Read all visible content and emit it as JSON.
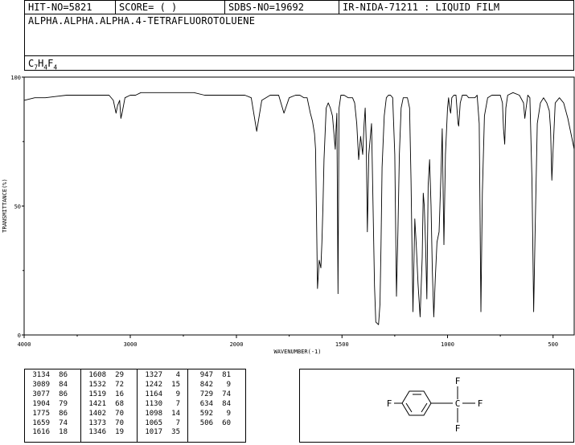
{
  "header": {
    "hit_no": "HIT-NO=5821",
    "score": "SCORE=  (   )",
    "sdbs_no": "SDBS-NO=19692",
    "ir_info": "IR-NIDA-71211 : LIQUID FILM"
  },
  "compound": {
    "name": "ALPHA.ALPHA.ALPHA.4-TETRAFLUOROTOLUENE",
    "formula_parts": [
      {
        "t": "C",
        "sub": false
      },
      {
        "t": "7",
        "sub": true
      },
      {
        "t": "H",
        "sub": false
      },
      {
        "t": "4",
        "sub": true
      },
      {
        "t": "F",
        "sub": false
      },
      {
        "t": "4",
        "sub": true
      }
    ]
  },
  "chart_data": {
    "type": "line",
    "xlabel": "WAVENUMBER(-1)",
    "ylabel": "TRANSMITTANCE(%)",
    "xlim": [
      4000,
      400
    ],
    "ylim": [
      0,
      100
    ],
    "x_ticks": [
      4000,
      3000,
      2000,
      1500,
      1000,
      500
    ],
    "x_tick_labels": [
      "4000",
      "3000",
      "2000",
      "1500",
      "1000",
      "500"
    ],
    "y_ticks": [
      0,
      50,
      100
    ],
    "y_tick_labels": [
      "0",
      "50",
      "100"
    ],
    "series": [
      {
        "x": [
          4000,
          3900,
          3800,
          3700,
          3600,
          3500,
          3400,
          3300,
          3200,
          3160,
          3134,
          3120,
          3100,
          3089,
          3077,
          3050,
          3000,
          2950,
          2900,
          2800,
          2700,
          2600,
          2500,
          2400,
          2300,
          2200,
          2100,
          2000,
          1960,
          1930,
          1904,
          1880,
          1840,
          1800,
          1775,
          1750,
          1720,
          1700,
          1680,
          1665,
          1650,
          1640,
          1630,
          1625,
          1616,
          1608,
          1600,
          1595,
          1590,
          1585,
          1575,
          1565,
          1555,
          1545,
          1535,
          1532,
          1528,
          1524,
          1519,
          1514,
          1505,
          1490,
          1470,
          1450,
          1440,
          1430,
          1421,
          1412,
          1402,
          1395,
          1390,
          1385,
          1380,
          1373,
          1360,
          1346,
          1340,
          1327,
          1320,
          1315,
          1310,
          1300,
          1290,
          1280,
          1270,
          1260,
          1250,
          1242,
          1235,
          1228,
          1220,
          1210,
          1200,
          1190,
          1180,
          1173,
          1164,
          1155,
          1148,
          1140,
          1130,
          1120,
          1115,
          1110,
          1104,
          1098,
          1092,
          1085,
          1078,
          1072,
          1065,
          1058,
          1050,
          1040,
          1030,
          1025,
          1017,
          1010,
          1000,
          995,
          990,
          985,
          980,
          970,
          960,
          950,
          947,
          940,
          930,
          920,
          910,
          900,
          880,
          870,
          860,
          850,
          842,
          835,
          825,
          810,
          790,
          770,
          750,
          740,
          735,
          729,
          724,
          715,
          690,
          660,
          640,
          634,
          628,
          620,
          610,
          600,
          592,
          585,
          575,
          560,
          545,
          530,
          518,
          512,
          506,
          500,
          490,
          470,
          450,
          430,
          400
        ],
        "y": [
          91,
          92,
          92,
          92.5,
          93,
          93,
          93,
          93,
          93,
          91,
          86,
          89,
          91,
          84,
          86,
          92,
          93,
          93,
          94,
          94,
          94,
          94,
          94,
          94,
          93,
          93,
          93,
          93,
          93,
          92,
          79,
          91,
          93,
          93,
          86,
          92,
          93,
          93,
          92,
          92,
          86,
          83,
          78,
          72,
          18,
          29,
          26,
          36,
          50,
          68,
          88,
          90,
          88,
          85,
          75,
          72,
          80,
          86,
          16,
          88,
          93,
          93,
          92,
          92,
          90,
          82,
          68,
          77,
          70,
          82,
          88,
          75,
          40,
          70,
          82,
          19,
          5,
          4,
          12,
          35,
          65,
          85,
          92,
          93,
          93,
          92,
          70,
          15,
          40,
          70,
          88,
          92,
          92,
          92,
          88,
          60,
          9,
          45,
          35,
          20,
          7,
          30,
          55,
          50,
          35,
          14,
          58,
          68,
          50,
          25,
          7,
          22,
          36,
          40,
          65,
          80,
          35,
          70,
          88,
          92,
          88,
          86,
          92,
          93,
          93,
          82,
          81,
          90,
          93,
          93,
          93,
          92,
          92,
          92,
          93,
          82,
          9,
          55,
          85,
          92,
          93,
          93,
          93,
          90,
          80,
          74,
          88,
          93,
          94,
          93,
          90,
          84,
          88,
          93,
          92,
          60,
          9,
          40,
          82,
          90,
          92,
          90,
          87,
          80,
          60,
          72,
          90,
          92,
          90,
          84,
          72
        ]
      }
    ]
  },
  "peak_table": {
    "columns": [
      [
        [
          "3134",
          "86"
        ],
        [
          "3089",
          "84"
        ],
        [
          "3077",
          "86"
        ],
        [
          "1904",
          "79"
        ],
        [
          "1775",
          "86"
        ],
        [
          "1659",
          "74"
        ],
        [
          "1616",
          "18"
        ]
      ],
      [
        [
          "1608",
          "29"
        ],
        [
          "1532",
          "72"
        ],
        [
          "1519",
          "16"
        ],
        [
          "1421",
          "68"
        ],
        [
          "1402",
          "70"
        ],
        [
          "1373",
          "70"
        ],
        [
          "1346",
          "19"
        ]
      ],
      [
        [
          "1327",
          "4"
        ],
        [
          "1242",
          "15"
        ],
        [
          "1164",
          "9"
        ],
        [
          "1130",
          "7"
        ],
        [
          "1098",
          "14"
        ],
        [
          "1065",
          "7"
        ],
        [
          "1017",
          "35"
        ]
      ],
      [
        [
          "947",
          "81"
        ],
        [
          "842",
          "9"
        ],
        [
          "729",
          "74"
        ],
        [
          "634",
          "84"
        ],
        [
          "592",
          "9"
        ],
        [
          "506",
          "60"
        ]
      ]
    ]
  },
  "structure": {
    "labels": [
      "F",
      "F",
      "F",
      "F",
      "C"
    ]
  }
}
